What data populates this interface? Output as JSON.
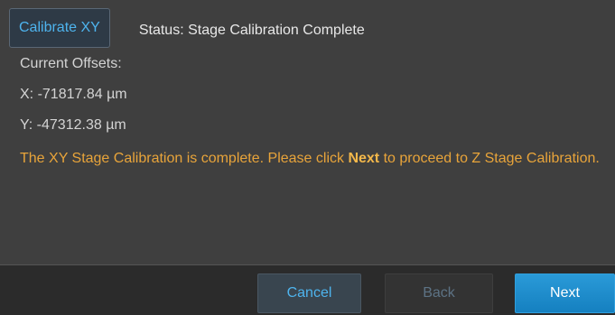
{
  "header": {
    "calibrate_button": "Calibrate XY",
    "status_text": "Status: Stage Calibration Complete"
  },
  "offsets": {
    "heading": "Current Offsets:",
    "x": "X:  -71817.84 µm",
    "y": "Y:  -47312.38 µm"
  },
  "message": {
    "before": "The XY Stage Calibration is complete. Please click ",
    "emphasis": "Next",
    "after": " to proceed to Z Stage Calibration."
  },
  "footer": {
    "cancel_label": "Cancel",
    "back_label": "Back",
    "next_label": "Next"
  },
  "colors": {
    "accent": "#4eb4ee",
    "message": "#e8a43a",
    "next_button": "#1b8cce"
  }
}
